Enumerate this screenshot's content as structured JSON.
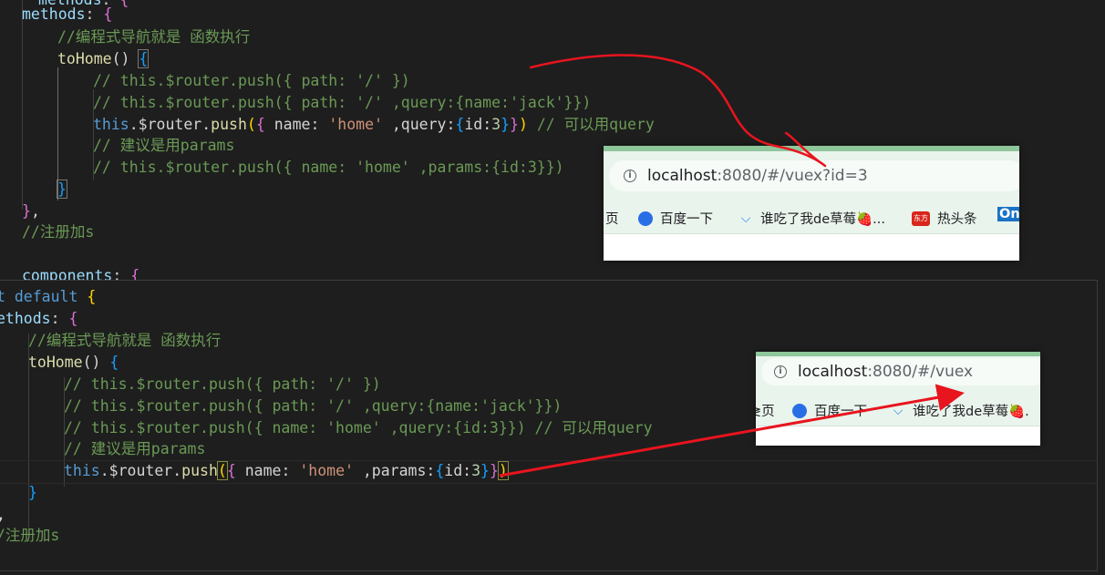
{
  "editor_top": {
    "lines": [
      "  methods: {",
      "methods: {",
      "    //编程式导航就是 函数执行",
      "    toHome() {",
      "      // this.$router.push({ path: '/' })",
      "      // this.$router.push({ path: '/' ,query:{name:'jack'}})",
      "      this.$router.push({ name: 'home' ,query:{id:3}}) // 可以用query",
      "      // 建议是用params",
      "      // this.$router.push({ name: 'home' ,params:{id:3}})",
      "    }",
      "},",
      "//注册加s",
      "",
      "components: {"
    ]
  },
  "editor_bottom": {
    "lines": [
      "t default {",
      "methods: {",
      "  //编程式导航就是 函数执行",
      "  toHome() {",
      "    // this.$router.push({ path: '/' })",
      "    // this.$router.push({ path: '/' ,query:{name:'jack'}})",
      "    // this.$router.push({ name: 'home' ,query:{id:3}}) // 可以用query",
      "    // 建议是用params",
      "    this.$router.push({ name: 'home' ,params:{id:3}})",
      "  }",
      ",",
      "/注册加s"
    ]
  },
  "browser_top": {
    "url_host": "localhost",
    "url_rest": ":8080/#/vuex?id=3",
    "bookmarks": [
      "页",
      "百度一下",
      "谁吃了我de草莓🍓...",
      "热头条",
      "On"
    ],
    "badge_text": "东方"
  },
  "browser_bottom": {
    "url_host": "localhost",
    "url_rest": ":8080/#/vuex",
    "bookmarks": [
      "≷页",
      "百度一下",
      "谁吃了我de草莓🍓."
    ]
  },
  "colors": {
    "editor_bg": "#1e1e1e",
    "comment": "#6a9955",
    "keyword": "#569cd6",
    "string": "#ce9178",
    "arrow": "#e8141e"
  }
}
